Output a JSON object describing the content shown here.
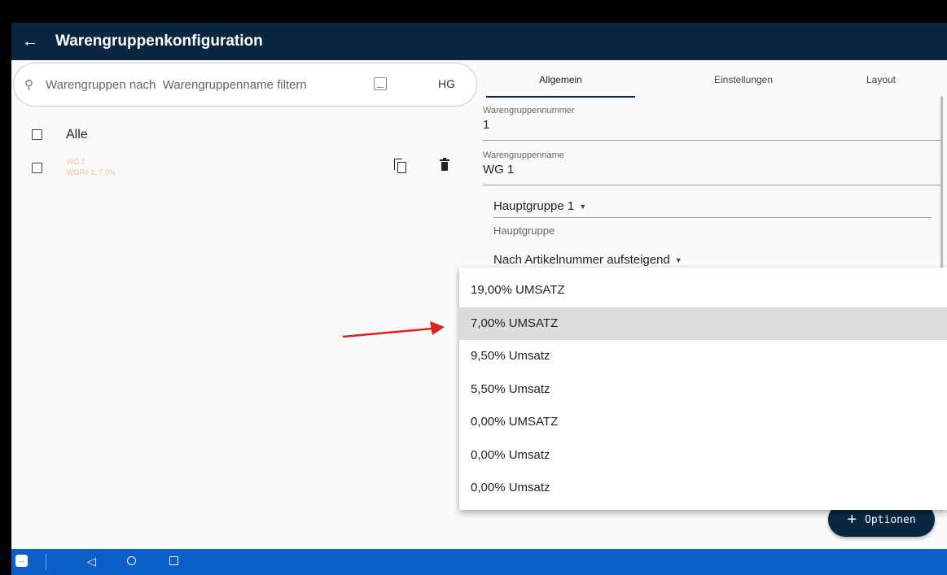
{
  "appbar": {
    "title": "Warengruppenkonfiguration",
    "back_icon": "←"
  },
  "search": {
    "placeholder": "Warengruppen nach  Warengruppenname filtern",
    "search_icon": "⚲",
    "hg_label": "HG"
  },
  "list": {
    "alle_label": "Alle",
    "items": [
      {
        "name": "WG 1",
        "subtitle": "WGR# 1, 7,0%"
      }
    ]
  },
  "tabs": [
    {
      "label": "Allgemein",
      "active": true
    },
    {
      "label": "Einstellungen",
      "active": false
    },
    {
      "label": "Layout",
      "active": false
    }
  ],
  "form": {
    "nummer_label": "Warengruppennummer",
    "nummer_value": "1",
    "name_label": "Warengruppenname",
    "name_value": "WG 1",
    "hauptgruppe_value": "Hauptgruppe 1",
    "hauptgruppe_label": "Hauptgruppe",
    "sortierung_value": "Nach Artikelnummer aufsteigend",
    "caret": "▼"
  },
  "dropdown": {
    "options": [
      {
        "label": "19,00% UMSATZ"
      },
      {
        "label": "7,00% UMSATZ",
        "highlighted": true
      },
      {
        "label": "9,50% Umsatz"
      },
      {
        "label": "5,50% Umsatz"
      },
      {
        "label": "0,00% UMSATZ"
      },
      {
        "label": "0,00% Umsatz"
      },
      {
        "label": "0,00% Umsatz"
      }
    ]
  },
  "fab": {
    "plus": "+",
    "label": "Optionen"
  },
  "navbar": {
    "back_icon": "◁",
    "tv_glyph": "⇔"
  },
  "colors": {
    "appbar": "#0b2641",
    "navbar": "#0a5fc8",
    "arrow": "#e02020",
    "item_text": "#f6c08f"
  }
}
